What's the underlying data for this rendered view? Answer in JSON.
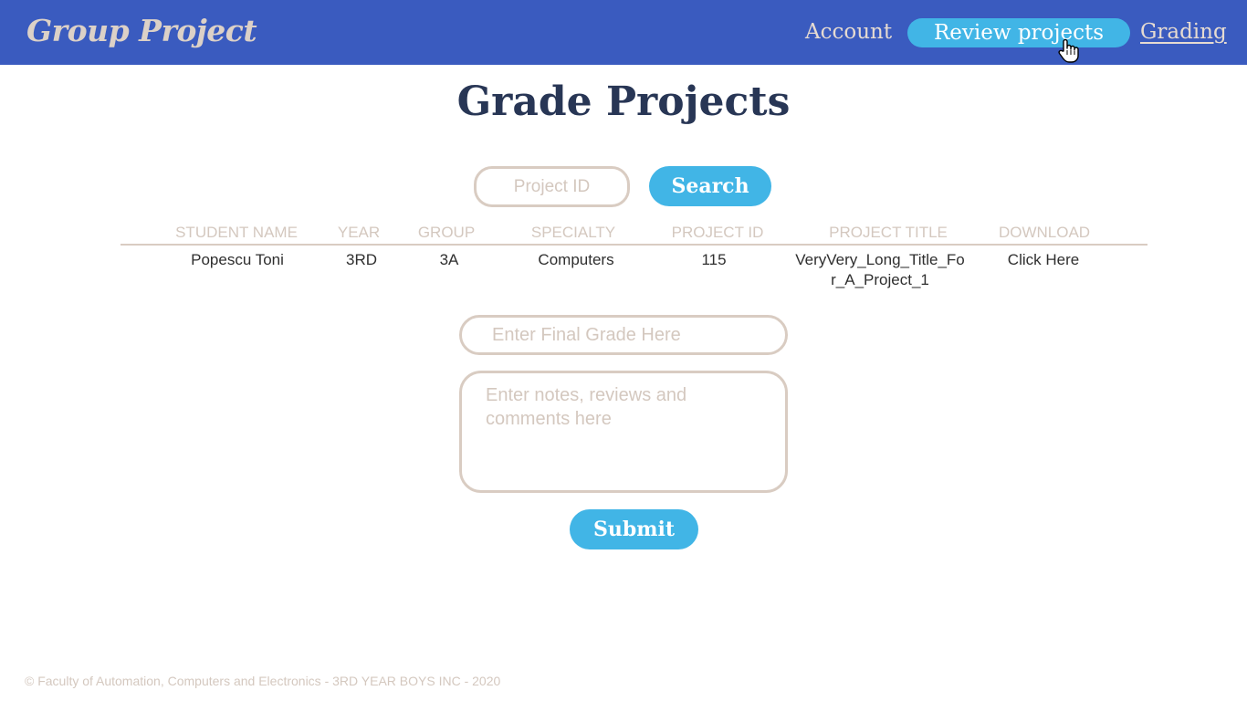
{
  "header": {
    "logo": "Group Project",
    "nav": {
      "account": "Account",
      "review_projects": "Review projects",
      "grading": "Grading"
    }
  },
  "main": {
    "title": "Grade Projects",
    "search": {
      "placeholder": "Project ID",
      "button_label": "Search"
    },
    "table": {
      "columns": [
        "STUDENT NAME",
        "YEAR",
        "GROUP",
        "SPECIALTY",
        "PROJECT ID",
        "PROJECT TITLE",
        "DOWNLOAD"
      ],
      "rows": [
        [
          "Popescu Toni",
          "3RD",
          "3A",
          "Computers",
          "115",
          "VeryVery_Long_Title_For_A_Project_1",
          "Click Here"
        ]
      ]
    },
    "form": {
      "grade_placeholder": "Enter Final Grade Here",
      "notes_placeholder": "Enter notes, reviews and comments here",
      "submit_label": "Submit"
    }
  },
  "footer": {
    "text": "© Faculty of Automation, Computers and Electronics - 3RD YEAR BOYS INC - 2020"
  },
  "colors": {
    "navbar": "#3a5bbf",
    "accent": "#41b5e6",
    "title": "#283655",
    "muted": "#d4c8bf"
  },
  "icons": {
    "cursor": "hand-pointer-icon"
  }
}
